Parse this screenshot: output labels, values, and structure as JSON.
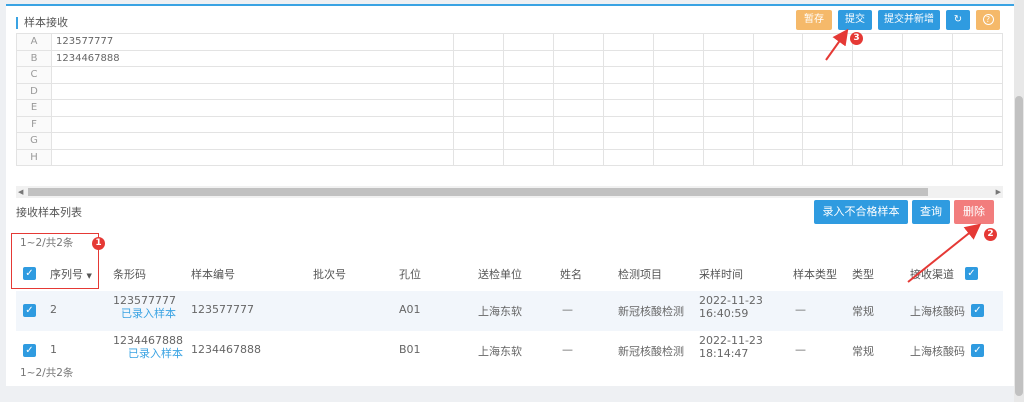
{
  "header": {
    "title": "样本接收"
  },
  "toolbar": {
    "temp_save": "暂存",
    "submit": "提交",
    "submit_new": "提交并新增",
    "refresh_icon": "↻",
    "help_icon": "?"
  },
  "grid": {
    "rows": [
      {
        "label": "A",
        "value": "123577777"
      },
      {
        "label": "B",
        "value": "1234467888"
      },
      {
        "label": "C",
        "value": ""
      },
      {
        "label": "D",
        "value": ""
      },
      {
        "label": "E",
        "value": ""
      },
      {
        "label": "F",
        "value": ""
      },
      {
        "label": "G",
        "value": ""
      },
      {
        "label": "H",
        "value": ""
      }
    ]
  },
  "list": {
    "title": "接收样本列表",
    "btn_unqualified": "录入不合格样本",
    "btn_query": "查询",
    "btn_delete": "删除",
    "pager_top": "1~2/共2条",
    "pager_bottom": "1~2/共2条",
    "columns": {
      "seq": "序列号",
      "barcode": "条形码",
      "sample_no": "样本编号",
      "batch": "批次号",
      "well": "孔位",
      "unit": "送检单位",
      "name": "姓名",
      "item": "检测项目",
      "time": "采样时间",
      "sample_type": "样本类型",
      "type": "类型",
      "channel": "接收渠道"
    },
    "rows": [
      {
        "seq": "2",
        "barcode": "123577777",
        "status": "已录入样本",
        "sample_no": "123577777",
        "batch": "",
        "well": "A01",
        "unit": "上海东软",
        "name": "—",
        "item": "新冠核酸检测",
        "date": "2022-11-23",
        "clock": "16:40:59",
        "sample_type": "—",
        "type": "常规",
        "channel": "上海核酸码"
      },
      {
        "seq": "1",
        "barcode": "1234467888",
        "status": "已录入样本",
        "sample_no": "1234467888",
        "batch": "",
        "well": "B01",
        "unit": "上海东软",
        "name": "—",
        "item": "新冠核酸检测",
        "date": "2022-11-23",
        "clock": "18:14:47",
        "sample_type": "—",
        "type": "常规",
        "channel": "上海核酸码"
      }
    ]
  },
  "markers": {
    "one": "1",
    "two": "2",
    "three": "3"
  },
  "colors": {
    "accent": "#2f9be0",
    "warning": "#f5b96a",
    "danger": "#f27d7d",
    "marker": "#e53935"
  }
}
